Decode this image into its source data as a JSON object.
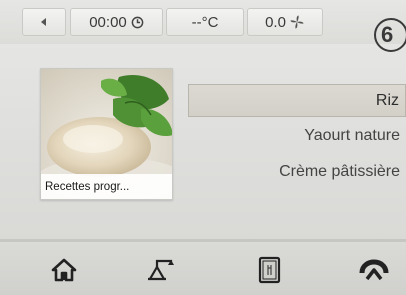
{
  "status_bar": {
    "back_icon": "left-arrow-icon",
    "timer": "00:00",
    "timer_icon": "clock-icon",
    "temperature": "--°C",
    "speed": "0.0",
    "speed_icon": "fan-icon",
    "badge": "6"
  },
  "recipe_card": {
    "label": "Recettes progr..."
  },
  "recipe_list": {
    "items": [
      {
        "label": "Riz"
      },
      {
        "label": "Yaourt nature"
      },
      {
        "label": "Crème pâtissière"
      }
    ]
  },
  "bottom_nav": {
    "items": [
      "home-icon",
      "scale-icon",
      "recipe-book-icon",
      "turbo-icon"
    ]
  },
  "colors": {
    "background": "#dfdfdd",
    "selected_row": "#d5d2ca",
    "text": "#444444",
    "icon": "#2a2a2a"
  }
}
